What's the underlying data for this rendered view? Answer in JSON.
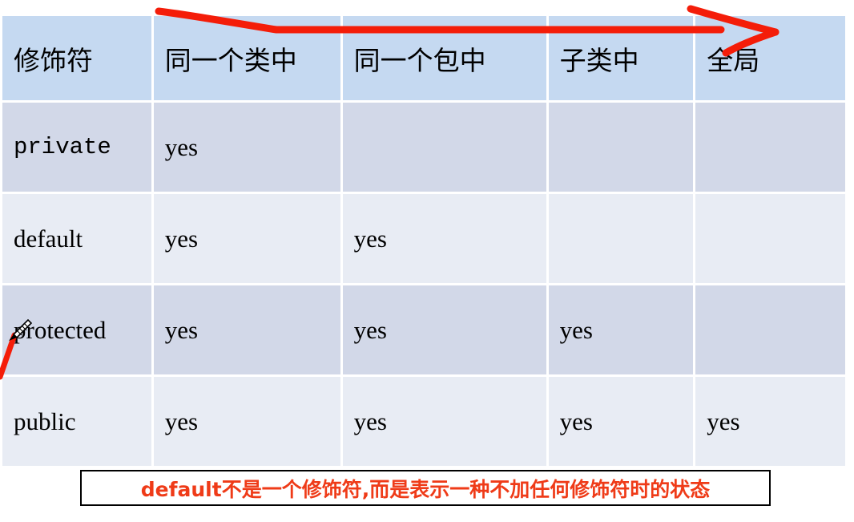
{
  "table": {
    "headers": [
      "修饰符",
      "同一个类中",
      "同一个包中",
      "子类中",
      "全局"
    ],
    "rows": [
      {
        "modifier": "private",
        "same_class": "yes",
        "same_package": "",
        "subclass": "",
        "global": ""
      },
      {
        "modifier": "default",
        "same_class": "yes",
        "same_package": "yes",
        "subclass": "",
        "global": ""
      },
      {
        "modifier": "protected",
        "same_class": "yes",
        "same_package": "yes",
        "subclass": "yes",
        "global": ""
      },
      {
        "modifier": "public",
        "same_class": "yes",
        "same_package": "yes",
        "subclass": "yes",
        "global": "yes"
      }
    ]
  },
  "caption": {
    "text": "default不是一个修饰符,而是表示一种不加任何修饰符时的状态",
    "color": "#ef3b18"
  },
  "annotations": {
    "arrow": {
      "name": "red-arrow-annotation",
      "color": "#f41d09",
      "direction": "right"
    },
    "cursor": {
      "name": "pen-cursor",
      "stroke_color": "#f41d09"
    }
  },
  "colors": {
    "header_background": "#c5d9f1",
    "row_odd_background": "#d2d8e8",
    "row_even_background": "#e8ecf4",
    "page_background": "#ffffff",
    "text": "#000000"
  }
}
